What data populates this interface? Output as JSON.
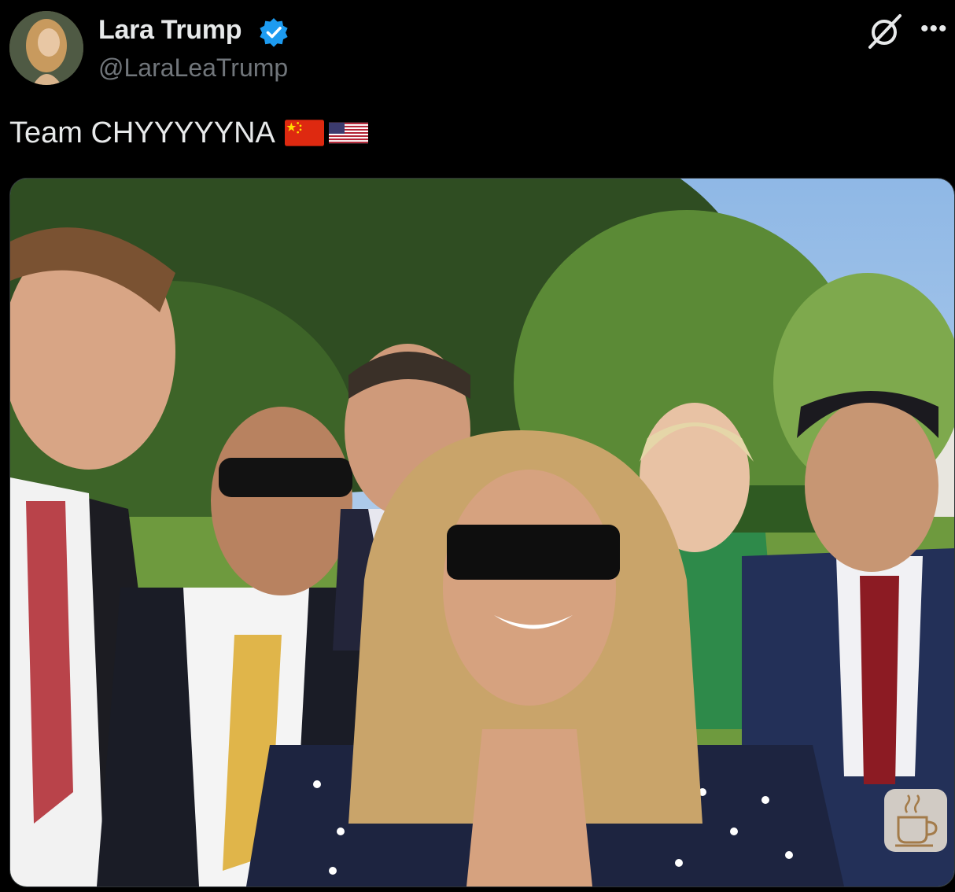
{
  "author": {
    "display_name": "Lara Trump",
    "handle": "@LaraLeaTrump",
    "verified": true,
    "verified_color": "#1d9bf0"
  },
  "tweet": {
    "text": "Team CHYYYYYNA",
    "emoji": [
      "china-flag-icon",
      "usa-flag-icon"
    ]
  },
  "media": {
    "type": "photo"
  },
  "icons": {
    "grok": "grok-icon",
    "more": "more-options-icon",
    "coffee": "coffee-cup-icon",
    "more_glyph": "•••"
  }
}
